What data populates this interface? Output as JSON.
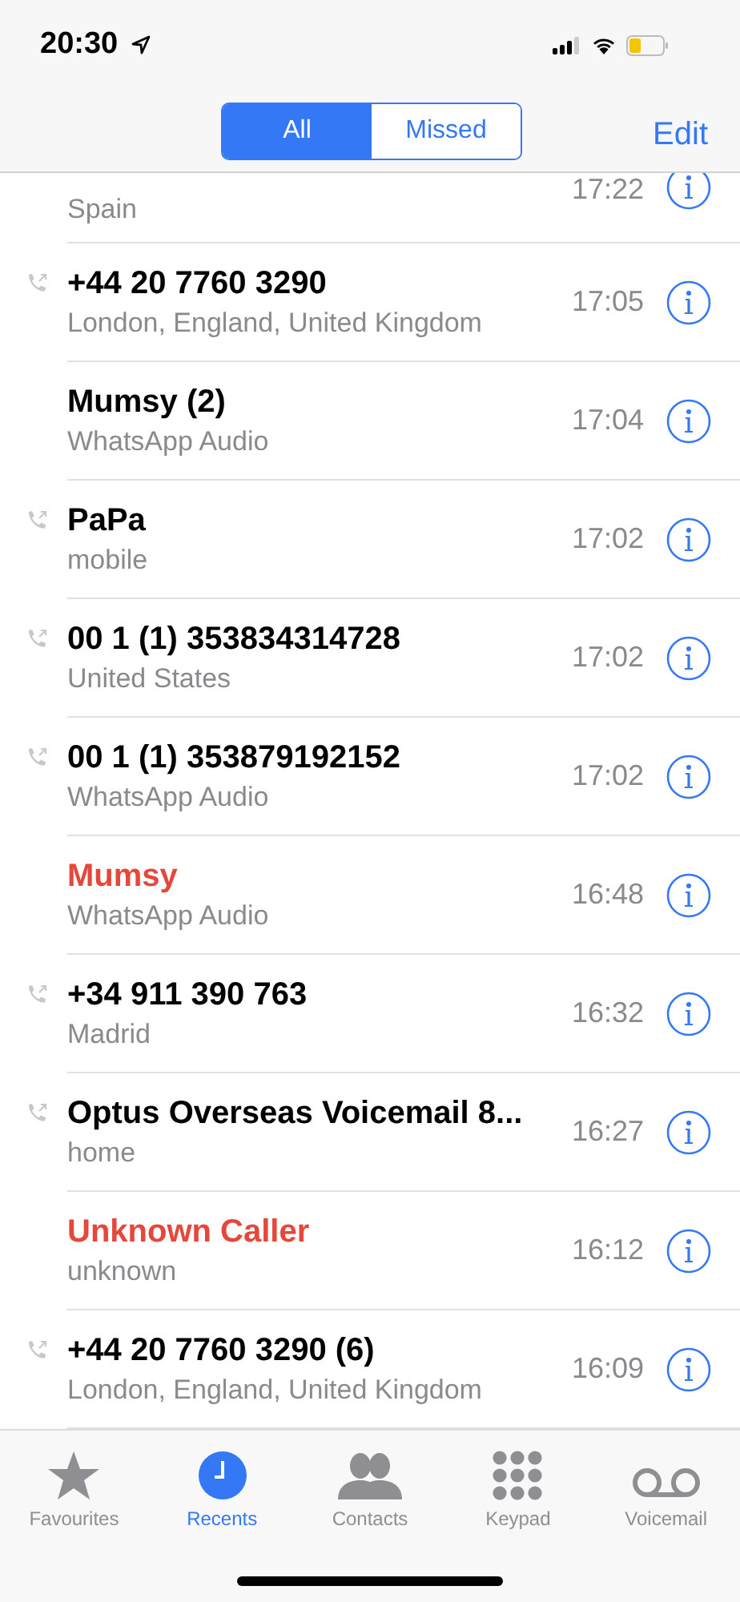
{
  "status_bar": {
    "time": "20:30"
  },
  "segments": [
    {
      "label": "All",
      "selected": true
    },
    {
      "label": "Missed",
      "selected": false
    }
  ],
  "edit_button": "Edit",
  "calls": [
    {
      "detail": "Spain",
      "time": "17:22"
    },
    {
      "name": "+44 20 7760 3290",
      "detail": "London, England, United Kingdom",
      "time": "17:05",
      "outgoing": true,
      "missed": false
    },
    {
      "name": "Mumsy (2)",
      "detail": "WhatsApp Audio",
      "time": "17:04",
      "outgoing": false,
      "missed": false
    },
    {
      "name": "PaPa",
      "detail": "mobile",
      "time": "17:02",
      "outgoing": true,
      "missed": false
    },
    {
      "name": "00 1 (1) 353834314728",
      "detail": "United States",
      "time": "17:02",
      "outgoing": true,
      "missed": false
    },
    {
      "name": "00 1 (1) 353879192152",
      "detail": "WhatsApp Audio",
      "time": "17:02",
      "outgoing": true,
      "missed": false
    },
    {
      "name": "Mumsy",
      "detail": "WhatsApp Audio",
      "time": "16:48",
      "outgoing": false,
      "missed": true
    },
    {
      "name": "+34 911 390 763",
      "detail": "Madrid",
      "time": "16:32",
      "outgoing": true,
      "missed": false
    },
    {
      "name": "Optus Overseas Voicemail  8...",
      "detail": "home",
      "time": "16:27",
      "outgoing": true,
      "missed": false
    },
    {
      "name": "Unknown Caller",
      "detail": "unknown",
      "time": "16:12",
      "outgoing": false,
      "missed": true
    },
    {
      "name": "+44 20 7760 3290 (6)",
      "detail": "London, England, United Kingdom",
      "time": "16:09",
      "outgoing": true,
      "missed": false
    }
  ],
  "tabs": [
    {
      "kind": "star",
      "label": "Favourites",
      "selected": false
    },
    {
      "kind": "clock",
      "label": "Recents",
      "selected": true
    },
    {
      "kind": "people",
      "label": "Contacts",
      "selected": false
    },
    {
      "kind": "keypad",
      "label": "Keypad",
      "selected": false
    },
    {
      "kind": "voicemail",
      "label": "Voicemail",
      "selected": false
    }
  ]
}
